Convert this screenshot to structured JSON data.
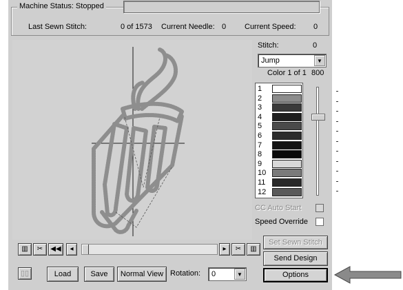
{
  "status": {
    "machine_status": "Machine Status: Stopped",
    "progress_fraction": 0,
    "last_sewn_label": "Last Sewn Stitch:",
    "last_sewn_value": "0 of 1573",
    "current_needle_label": "Current Needle:",
    "current_needle_value": "0",
    "current_speed_label": "Current Speed:",
    "current_speed_value": "0"
  },
  "side": {
    "stitch_label": "Stitch:",
    "stitch_value": "0",
    "stitch_type": "Jump",
    "color_label": "Color 1 of 1",
    "color_count": "800",
    "colors": [
      {
        "num": "1",
        "hex": "#ffffff"
      },
      {
        "num": "2",
        "hex": "#8c8c8c"
      },
      {
        "num": "3",
        "hex": "#3a3a3a"
      },
      {
        "num": "4",
        "hex": "#1e1e1e"
      },
      {
        "num": "5",
        "hex": "#4a4a4a"
      },
      {
        "num": "6",
        "hex": "#2c2c2c"
      },
      {
        "num": "7",
        "hex": "#141414"
      },
      {
        "num": "8",
        "hex": "#0a0a0a"
      },
      {
        "num": "9",
        "hex": "#d8d8d8"
      },
      {
        "num": "10",
        "hex": "#7a7a7a"
      },
      {
        "num": "11",
        "hex": "#2a2a2a"
      },
      {
        "num": "12",
        "hex": "#5a5a5a"
      }
    ],
    "cc_auto_start": "CC Auto Start",
    "speed_override": "Speed Override",
    "set_sewn_stitch": "Set Sewn Stitch",
    "send_design": "Send Design",
    "options": "Options"
  },
  "bottom": {
    "load": "Load",
    "save": "Save",
    "normal_view": "Normal View",
    "rotation_label": "Rotation:",
    "rotation_value": "0"
  },
  "icons": {
    "transport": [
      "machine-icon",
      "scissors-icon",
      "rewind-icon",
      "scroll-left-arrow-icon",
      "scroll-right-arrow-icon",
      "scissors-icon",
      "machine-icon"
    ],
    "pause": "pause-icon",
    "pointer": "arrow-left-icon"
  },
  "colors": {
    "dialog_bg": "#cfcfcf",
    "stitch_color": "#8e8e8e"
  }
}
